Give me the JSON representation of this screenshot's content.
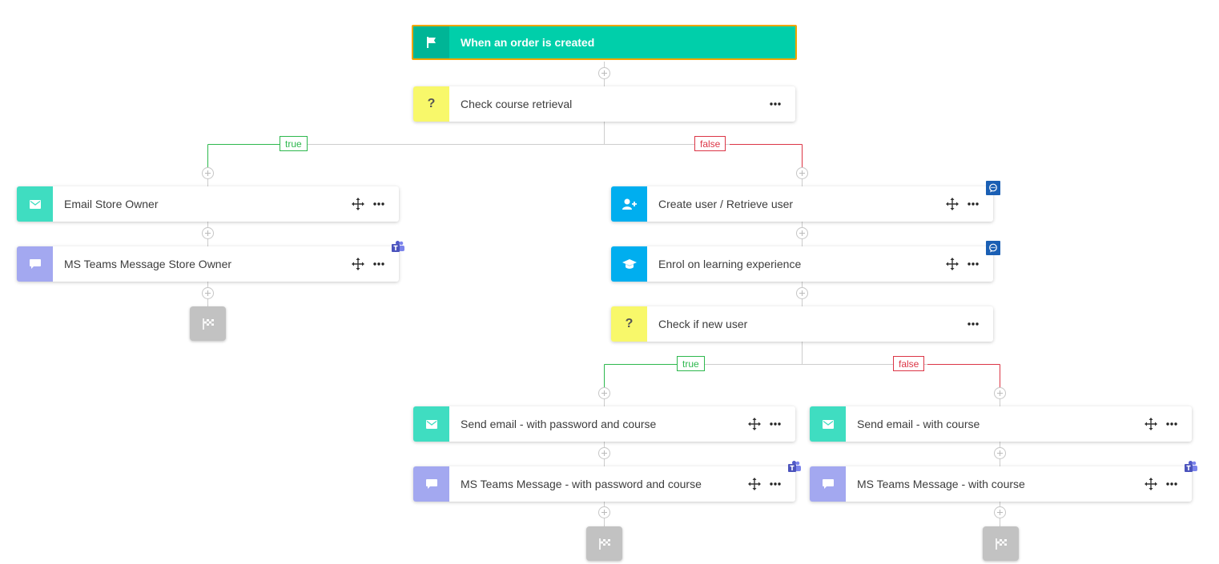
{
  "trigger": {
    "label": "When an order is created",
    "icon": "flag-icon"
  },
  "nodes": {
    "check_course": {
      "label": "Check course retrieval",
      "icon": "question-icon"
    },
    "email_store_owner": {
      "label": "Email Store Owner",
      "icon": "envelope-icon"
    },
    "teams_store_owner": {
      "label": "MS Teams Message Store Owner",
      "icon": "chat-icon"
    },
    "create_user": {
      "label": "Create user / Retrieve user",
      "icon": "user-plus-icon"
    },
    "enrol": {
      "label": "Enrol on learning experience",
      "icon": "graduation-cap-icon"
    },
    "check_new_user": {
      "label": "Check if new user",
      "icon": "question-icon"
    },
    "send_email_pw": {
      "label": "Send email - with password and course",
      "icon": "envelope-icon"
    },
    "send_email_course": {
      "label": "Send email - with course",
      "icon": "envelope-icon"
    },
    "teams_pw": {
      "label": "MS Teams Message - with password and course",
      "icon": "chat-icon"
    },
    "teams_course": {
      "label": "MS Teams Message - with course",
      "icon": "chat-icon"
    }
  },
  "branches": {
    "check_course_true": "true",
    "check_course_false": "false",
    "check_new_user_true": "true",
    "check_new_user_false": "false"
  },
  "colors": {
    "trigger": "#00cfaa",
    "trigger_border": "#f0a500",
    "email": "#3fddc1",
    "teams": "#a3a8f0",
    "condition": "#f8f86a",
    "user": "#00aeef",
    "true_branch": "#2db84d",
    "false_branch": "#dc3545",
    "connector": "#c8c8c8",
    "end": "#c2c2c2"
  }
}
